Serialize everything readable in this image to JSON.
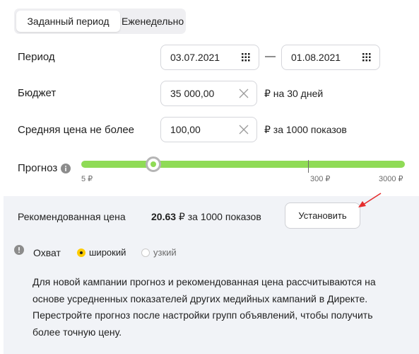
{
  "tabs": {
    "active_label": "Заданный период",
    "inactive_label": "Еженедельно"
  },
  "period": {
    "label": "Период",
    "start": "03.07.2021",
    "separator": "—",
    "end": "01.08.2021"
  },
  "budget": {
    "label": "Бюджет",
    "value": "35 000,00",
    "suffix": "₽ на 30 дней"
  },
  "avg_price": {
    "label": "Средняя цена не более",
    "value": "100,00",
    "suffix": "₽ за 1000 показов"
  },
  "forecast": {
    "label": "Прогноз",
    "min_label": "5 ₽",
    "mid_label": "300 ₽",
    "max_label": "3000 ₽",
    "slider_value_rub": 100
  },
  "recommended": {
    "label": "Рекомендованная цена",
    "price": "20.63",
    "price_suffix": " ₽ за 1000 показов",
    "install_button": "Установить"
  },
  "reach": {
    "label": "Охват",
    "options": [
      {
        "label": "широкий",
        "selected": true
      },
      {
        "label": "узкий",
        "selected": false
      }
    ]
  },
  "note": {
    "lines": [
      "Для новой кампании прогноз и рекомендованная цена рассчитываются на",
      "основе усредненных показателей других медийных кампаний в Директе.",
      "Перестройте прогноз после настройки групп объявлений, чтобы получить",
      "более точную цену."
    ]
  },
  "colors": {
    "slider": "#8fdb56",
    "radio_selected": "#ffcc00",
    "panel_bg": "#f1f3f7",
    "arrow": "#e52d2d"
  }
}
